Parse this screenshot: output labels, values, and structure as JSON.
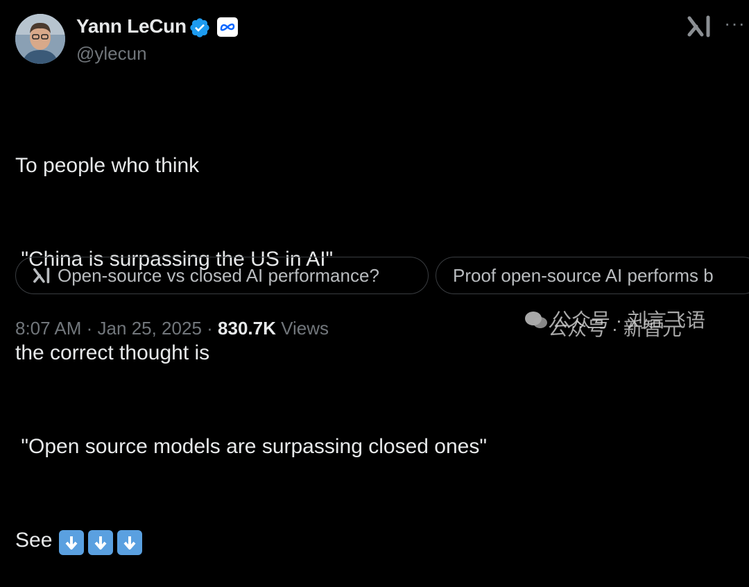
{
  "author": {
    "name": "Yann LeCun",
    "handle": "@ylecun",
    "verified_color": "#1d9bf0",
    "affiliation_icon": "meta-logo"
  },
  "header": {
    "grok_icon": "grok-icon",
    "more_label": "···"
  },
  "tweet": {
    "lines": [
      "To people who think",
      " \"China is surpassing the US in AI\"",
      "the correct thought is",
      " \"Open source models are surpassing closed ones\"",
      "See"
    ],
    "emojis": [
      "down-arrow-emoji",
      "down-arrow-emoji",
      "down-arrow-emoji"
    ]
  },
  "grok_suggestions": [
    "Open-source vs closed AI performance?",
    "Proof open-source AI performs b"
  ],
  "meta": {
    "time": "8:07 AM",
    "sep1": "·",
    "date": "Jan 25, 2025",
    "sep2": "·",
    "views_count": "830.7K",
    "views_label": "Views"
  },
  "watermark": {
    "line1": "公众号 · 刘言飞语",
    "line2": "公众号 · 新智元"
  }
}
